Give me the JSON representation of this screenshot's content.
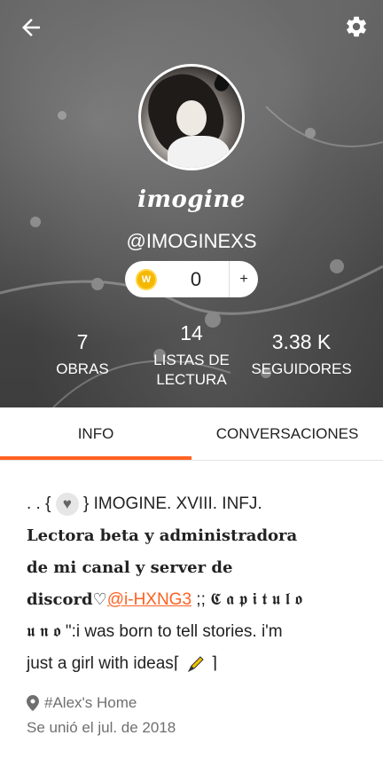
{
  "header": {
    "display_name": "imogine",
    "username": "@IMOGINEXS",
    "coins": {
      "count": "0",
      "plus_label": "+",
      "icon_letter": "W"
    },
    "stats": [
      {
        "value": "7",
        "label_lines": [
          "OBRAS"
        ]
      },
      {
        "value": "14",
        "label_lines": [
          "LISTAS DE",
          "LECTURA"
        ]
      },
      {
        "value": "3.38 K",
        "label_lines": [
          "SEGUIDORES"
        ]
      }
    ]
  },
  "tabs": {
    "info": "INFO",
    "conversations": "CONVERSACIONES",
    "active": "info"
  },
  "bio": {
    "line1_prefix": ". . {",
    "line1_suffix": "} IMOGINE. XVIII. INFJ.",
    "line2": "Lectora beta y administradora",
    "line3": "de mi canal y server de",
    "line4_prefix": "discord♡",
    "mention": "@i-HXNG3",
    "line4_suffix": " ;; 𝕮 𝖆 𝖕 𝖎 𝖙 𝖚 𝖑 𝖔",
    "line5": "𝖚 𝖓 𝖔 \":i was born to tell stories. i'm",
    "line6_prefix": "just a girl with ideas⌈",
    "line6_suffix": "⌉"
  },
  "meta": {
    "location": "#Alex's Home",
    "joined": "Se unió el jul. de 2018"
  },
  "colors": {
    "accent": "#ff6122",
    "coin": "#f5b800"
  }
}
